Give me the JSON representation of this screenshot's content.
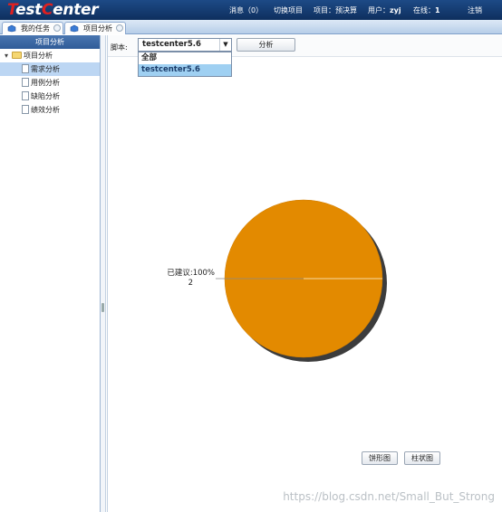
{
  "header": {
    "logo_prefix": "T",
    "logo_text": "est",
    "logo_accent": "C",
    "logo_suffix": "enter",
    "messages": "消息（0）",
    "switch_project": "切换项目",
    "project_label": "项目：预决算",
    "user_label": "用户：",
    "user_name": "zyj",
    "online_label": "在线：",
    "online_count": "1",
    "logout": "注销"
  },
  "tabs": [
    {
      "label": "我的任务"
    },
    {
      "label": "项目分析"
    }
  ],
  "sidebar": {
    "title": "项目分析",
    "root_label": "项目分析",
    "items": [
      {
        "label": "需求分析",
        "selected": true
      },
      {
        "label": "用例分析",
        "selected": false
      },
      {
        "label": "缺陷分析",
        "selected": false
      },
      {
        "label": "绩效分析",
        "selected": false
      }
    ]
  },
  "toolbar": {
    "script_label": "脚本:",
    "selected_value": "testcenter5.6",
    "options": [
      "全部",
      "testcenter5.6"
    ],
    "active_option_index": 1,
    "analyze_label": "分析"
  },
  "chart_data": {
    "type": "pie",
    "slices": [
      {
        "label": "已建议:100%",
        "value": 2,
        "percent": 100,
        "color": "#e38a00"
      }
    ]
  },
  "chart_buttons": {
    "pie_label": "饼形图",
    "bar_label": "柱状图"
  },
  "watermark": "https://blog.csdn.net/Small_But_Strong",
  "colors": {
    "header_bg": "#153c73",
    "accent_red": "#e02020",
    "slice": "#e38a00",
    "selection": "#9fd0f2"
  }
}
